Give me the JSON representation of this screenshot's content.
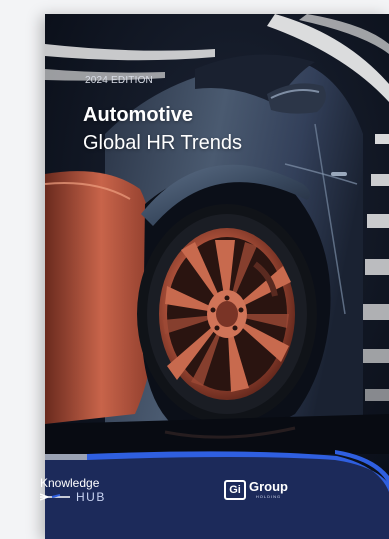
{
  "cover": {
    "edition": "2024 EDITION",
    "title_main": "Automotive",
    "title_sub": "Global HR Trends"
  },
  "footer": {
    "knowledge": "Knowledge",
    "hub": "HUB",
    "gi_mark": "Gi",
    "gi_word": "Group",
    "gi_holding": "HOLDING"
  },
  "colors": {
    "footer_navy": "#1c2a5a",
    "accent_blue": "#2f5fe0",
    "car_body": "#3a4658",
    "rim_copper": "#c8644a"
  }
}
